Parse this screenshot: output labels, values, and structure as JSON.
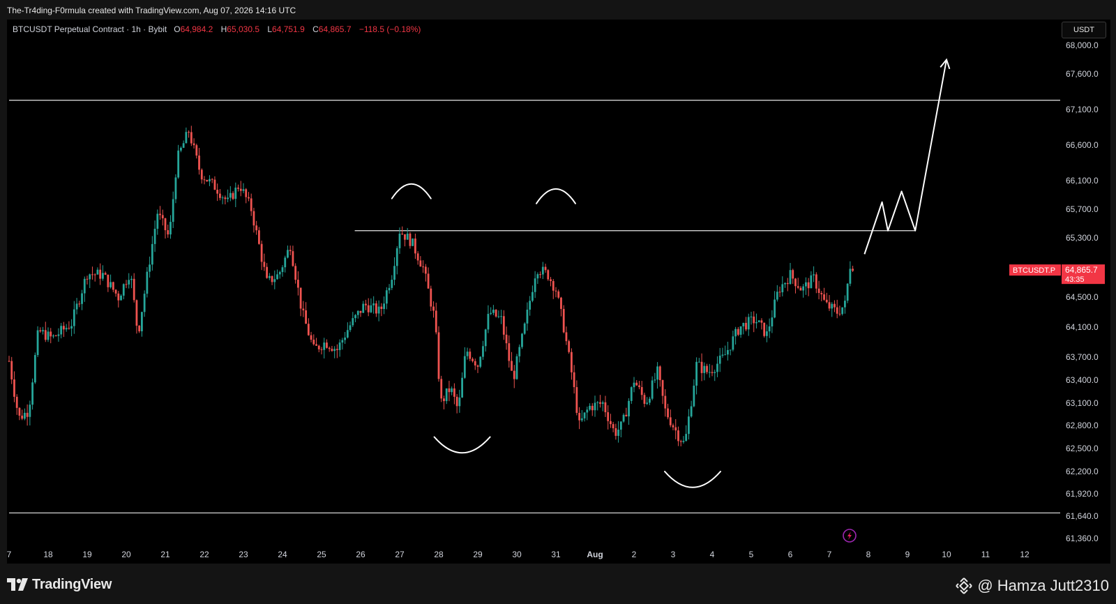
{
  "header": {
    "attribution": "The-Tr4ding-F0rmula created with TradingView.com, Aug 07, 2026 14:16 UTC"
  },
  "legend": {
    "symbol": "BTCUSDT Perpetual Contract · 1h · Bybit",
    "o_label": "O",
    "o_value": "64,984.2",
    "h_label": "H",
    "h_value": "65,030.5",
    "l_label": "L",
    "l_value": "64,751.9",
    "c_label": "C",
    "c_value": "64,865.7",
    "change": "−118.5 (−0.18%)"
  },
  "currency": "USDT",
  "price_tag": {
    "symbol": "BTCUSDT.P",
    "price": "64,865.7",
    "countdown": "43:35"
  },
  "footer": {
    "brand": "TradingView",
    "watermark": "@ Hamza Jutt2310"
  },
  "colors": {
    "up": "#26a69a",
    "down": "#ef5350",
    "background": "#000000",
    "annotation": "#ffffff",
    "tag": "#f23645"
  },
  "chart_data": {
    "type": "candlestick",
    "interval": "1h",
    "title": "",
    "xlabel": "",
    "ylabel": "",
    "x_ticks": [
      "7",
      "18",
      "19",
      "20",
      "21",
      "22",
      "23",
      "24",
      "25",
      "26",
      "27",
      "28",
      "29",
      "30",
      "31",
      "Aug",
      "2",
      "3",
      "4",
      "5",
      "6",
      "7",
      "8",
      "9",
      "10",
      "11",
      "12"
    ],
    "y_ticks": [
      "68,000.0",
      "67,600.0",
      "67,100.0",
      "66,600.0",
      "66,100.0",
      "65,700.0",
      "65,300.0",
      "64,500.0",
      "64,100.0",
      "63,700.0",
      "63,400.0",
      "63,100.0",
      "62,800.0",
      "62,500.0",
      "62,200.0",
      "61,920.0",
      "61,640.0",
      "61,360.0"
    ],
    "ylim": [
      61200,
      68100
    ],
    "xlim_days": [
      "Jul 17",
      "Aug 12"
    ],
    "grid": false,
    "price_path": [
      {
        "day": 17.0,
        "price": 63650
      },
      {
        "day": 17.25,
        "price": 62900
      },
      {
        "day": 17.5,
        "price": 63000
      },
      {
        "day": 17.75,
        "price": 64050
      },
      {
        "day": 18.1,
        "price": 63950
      },
      {
        "day": 18.6,
        "price": 64150
      },
      {
        "day": 19.0,
        "price": 64820
      },
      {
        "day": 19.4,
        "price": 64800
      },
      {
        "day": 19.8,
        "price": 64500
      },
      {
        "day": 20.1,
        "price": 64850
      },
      {
        "day": 20.3,
        "price": 64000
      },
      {
        "day": 20.6,
        "price": 65000
      },
      {
        "day": 20.8,
        "price": 65650
      },
      {
        "day": 21.1,
        "price": 65300
      },
      {
        "day": 21.3,
        "price": 66400
      },
      {
        "day": 21.6,
        "price": 66800
      },
      {
        "day": 21.9,
        "price": 66200
      },
      {
        "day": 22.3,
        "price": 66000
      },
      {
        "day": 22.6,
        "price": 65800
      },
      {
        "day": 22.9,
        "price": 66050
      },
      {
        "day": 23.2,
        "price": 65700
      },
      {
        "day": 23.6,
        "price": 64700
      },
      {
        "day": 23.9,
        "price": 64800
      },
      {
        "day": 24.2,
        "price": 65200
      },
      {
        "day": 24.5,
        "price": 64300
      },
      {
        "day": 24.8,
        "price": 63800
      },
      {
        "day": 25.1,
        "price": 63900
      },
      {
        "day": 25.4,
        "price": 63800
      },
      {
        "day": 25.7,
        "price": 64100
      },
      {
        "day": 26.1,
        "price": 64400
      },
      {
        "day": 26.5,
        "price": 64300
      },
      {
        "day": 26.8,
        "price": 64800
      },
      {
        "day": 27.0,
        "price": 65400
      },
      {
        "day": 27.3,
        "price": 65250
      },
      {
        "day": 27.6,
        "price": 64900
      },
      {
        "day": 27.9,
        "price": 64200
      },
      {
        "day": 28.05,
        "price": 63100
      },
      {
        "day": 28.3,
        "price": 63300
      },
      {
        "day": 28.5,
        "price": 63000
      },
      {
        "day": 28.7,
        "price": 63800
      },
      {
        "day": 29.0,
        "price": 63600
      },
      {
        "day": 29.3,
        "price": 64300
      },
      {
        "day": 29.6,
        "price": 64200
      },
      {
        "day": 29.9,
        "price": 63400
      },
      {
        "day": 30.2,
        "price": 64100
      },
      {
        "day": 30.5,
        "price": 64900
      },
      {
        "day": 30.8,
        "price": 64800
      },
      {
        "day": 31.0,
        "price": 64600
      },
      {
        "day": 31.2,
        "price": 64100
      },
      {
        "day": 31.4,
        "price": 63500
      },
      {
        "day": 31.6,
        "price": 62800
      },
      {
        "day": 31.85,
        "price": 63050
      },
      {
        "day": 32.2,
        "price": 63100
      },
      {
        "day": 32.5,
        "price": 62700
      },
      {
        "day": 32.7,
        "price": 62800
      },
      {
        "day": 33.0,
        "price": 63400
      },
      {
        "day": 33.3,
        "price": 63100
      },
      {
        "day": 33.6,
        "price": 63500
      },
      {
        "day": 33.8,
        "price": 63000
      },
      {
        "day": 34.1,
        "price": 62700
      },
      {
        "day": 34.3,
        "price": 62550
      },
      {
        "day": 34.6,
        "price": 63600
      },
      {
        "day": 34.9,
        "price": 63500
      },
      {
        "day": 35.3,
        "price": 63700
      },
      {
        "day": 35.7,
        "price": 64100
      },
      {
        "day": 36.1,
        "price": 64200
      },
      {
        "day": 36.4,
        "price": 64000
      },
      {
        "day": 36.7,
        "price": 64600
      },
      {
        "day": 37.0,
        "price": 64800
      },
      {
        "day": 37.3,
        "price": 64600
      },
      {
        "day": 37.6,
        "price": 64750
      },
      {
        "day": 37.9,
        "price": 64400
      },
      {
        "day": 38.2,
        "price": 64300
      },
      {
        "day": 38.4,
        "price": 64400
      },
      {
        "day": 38.55,
        "price": 65000
      },
      {
        "day": 38.65,
        "price": 64865.7
      }
    ],
    "horizontal_levels": [
      {
        "price": 67230,
        "from_day": 17.0,
        "to_day": 44.0
      },
      {
        "price": 65400,
        "from_day": 25.85,
        "to_day": 40.2
      },
      {
        "price": 61680,
        "from_day": 17.0,
        "to_day": 44.0
      }
    ],
    "projection_path": [
      {
        "day": 38.9,
        "price": 65080
      },
      {
        "day": 39.35,
        "price": 65800
      },
      {
        "day": 39.5,
        "price": 65400
      },
      {
        "day": 39.85,
        "price": 65950
      },
      {
        "day": 40.2,
        "price": 65400
      },
      {
        "day": 41.0,
        "price": 67800
      }
    ],
    "annotations": [
      {
        "shape": "arc-top",
        "center_day": 27.3,
        "price": 65850
      },
      {
        "shape": "arc-top",
        "center_day": 31.0,
        "price": 65780
      },
      {
        "shape": "arc-bottom",
        "center_day": 28.6,
        "price": 62650
      },
      {
        "shape": "arc-bottom",
        "center_day": 34.5,
        "price": 62200
      }
    ],
    "last_price": 64865.7
  }
}
